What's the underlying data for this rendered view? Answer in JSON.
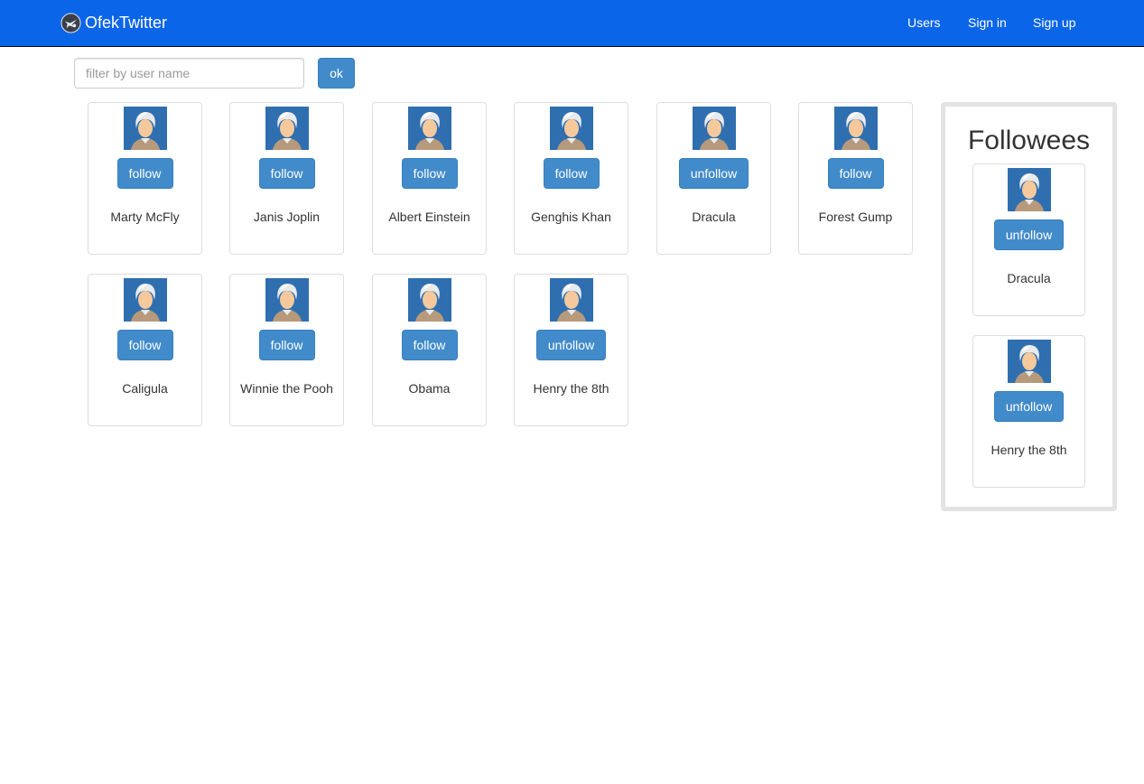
{
  "navbar": {
    "brand": "OfekTwitter",
    "links": [
      "Users",
      "Sign in",
      "Sign up"
    ]
  },
  "filter": {
    "placeholder": "filter by user name",
    "value": "",
    "ok_label": "ok"
  },
  "users": [
    {
      "name": "Marty McFly",
      "action": "follow"
    },
    {
      "name": "Janis Joplin",
      "action": "follow"
    },
    {
      "name": "Albert Einstein",
      "action": "follow"
    },
    {
      "name": "Genghis Khan",
      "action": "follow"
    },
    {
      "name": "Dracula",
      "action": "unfollow"
    },
    {
      "name": "Forest Gump",
      "action": "follow"
    },
    {
      "name": "Caligula",
      "action": "follow"
    },
    {
      "name": "Winnie the Pooh",
      "action": "follow"
    },
    {
      "name": "Obama",
      "action": "follow"
    },
    {
      "name": "Henry the 8th",
      "action": "unfollow"
    }
  ],
  "followees": {
    "title": "Followees",
    "items": [
      {
        "name": "Dracula",
        "action": "unfollow"
      },
      {
        "name": "Henry the 8th",
        "action": "unfollow"
      }
    ]
  },
  "colors": {
    "navbar": "#0b65e8",
    "button": "#428bca",
    "avatar_bg": "#2f6fb0"
  },
  "icons": {
    "brand": "bird-logo-icon",
    "avatar": "user-avatar-icon"
  }
}
